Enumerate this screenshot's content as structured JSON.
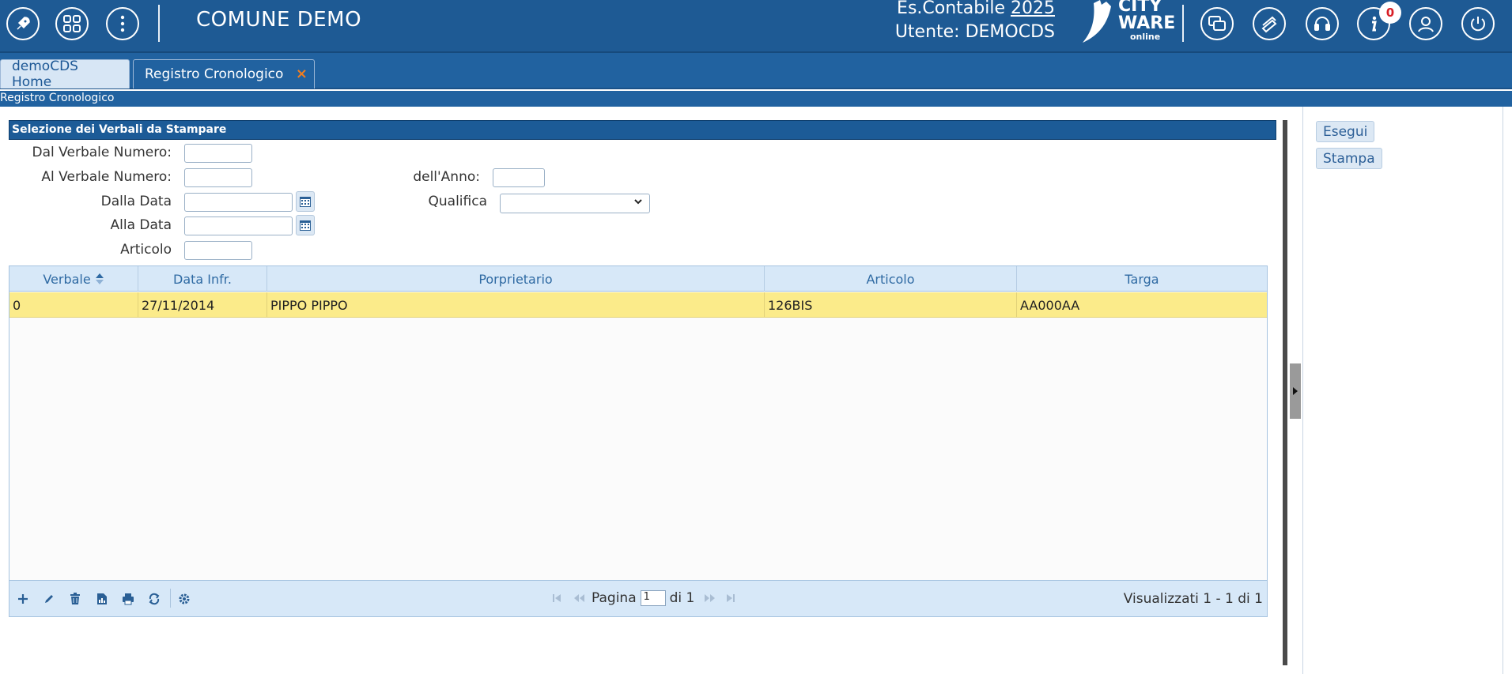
{
  "header": {
    "app_title": "COMUNE DEMO",
    "es_label": "Es.Contabile",
    "es_year": "2025",
    "user_label": "Utente: DEMOCDS",
    "logo_line1": "CITY",
    "logo_line2": "WARE",
    "logo_line3": "online",
    "notification_count": "0"
  },
  "tabs": [
    {
      "label": "demoCDS Home"
    },
    {
      "label": "Registro Cronologico",
      "close": "×"
    }
  ],
  "breadcrumb": "Registro Cronologico",
  "form": {
    "section_title": "Selezione dei Verbali da Stampare",
    "dal_verbale_label": "Dal Verbale Numero:",
    "al_verbale_label": "Al Verbale Numero:",
    "anno_label": "dell'Anno:",
    "dalla_data_label": "Dalla Data",
    "qualifica_label": "Qualifica",
    "alla_data_label": "Alla Data",
    "articolo_label": "Articolo"
  },
  "grid": {
    "columns": [
      "Verbale",
      "Data Infr.",
      "Porprietario",
      "Articolo",
      "Targa"
    ],
    "rows": [
      [
        "0",
        "27/11/2014",
        "PIPPO PIPPO",
        "126BIS",
        "AA000AA"
      ]
    ],
    "pager": {
      "page_label": "Pagina",
      "page_value": "1",
      "of_label": "di 1"
    },
    "visible_text": "Visualizzati 1 - 1 di 1"
  },
  "actions": {
    "esegui": "Esegui",
    "stampa": "Stampa"
  }
}
